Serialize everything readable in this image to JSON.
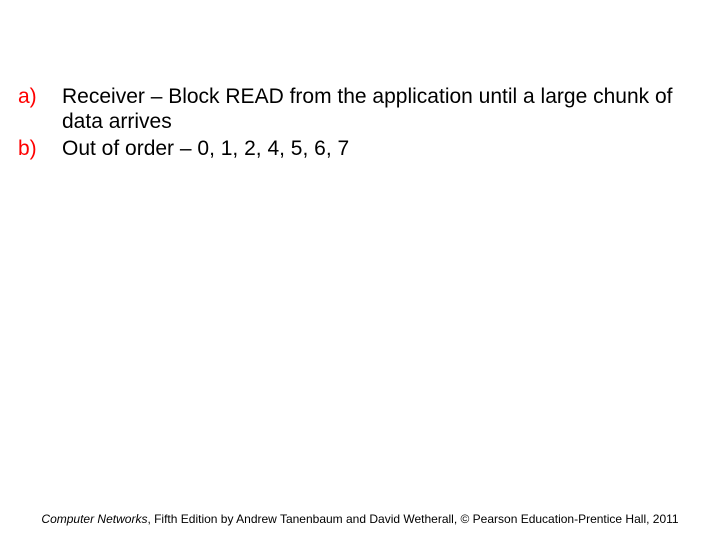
{
  "items": [
    {
      "marker": "a)",
      "text": "Receiver – Block READ from the application until a large chunk of data arrives"
    },
    {
      "marker": "b)",
      "text": "Out of order – 0, 1, 2, 4, 5, 6, 7"
    }
  ],
  "footer": {
    "book": "Computer Networks",
    "rest": ", Fifth Edition by Andrew Tanenbaum and David Wetherall, © Pearson Education-Prentice Hall, 2011"
  }
}
